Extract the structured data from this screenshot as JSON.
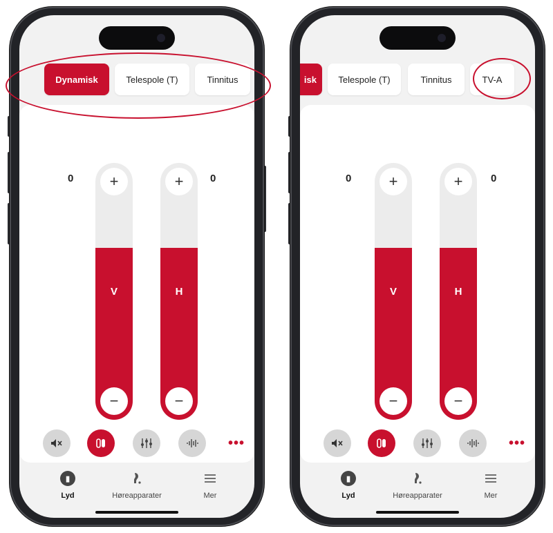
{
  "colors": {
    "accent": "#c8102e",
    "panel": "#ffffff",
    "background": "#f2f2f2"
  },
  "phones": [
    {
      "tabs": [
        {
          "label": "Dynamisk",
          "active": true
        },
        {
          "label": "Telespole (T)",
          "active": false
        },
        {
          "label": "Tinnitus",
          "active": false
        }
      ],
      "left_value": "0",
      "right_value": "0",
      "left_letter": "V",
      "right_letter": "H",
      "left_level": 0.67,
      "right_level": 0.67
    },
    {
      "tabs": [
        {
          "label": "isk",
          "active": true
        },
        {
          "label": "Telespole (T)",
          "active": false
        },
        {
          "label": "Tinnitus",
          "active": false
        },
        {
          "label": "TV-A",
          "active": false
        }
      ],
      "left_value": "0",
      "right_value": "0",
      "left_letter": "V",
      "right_letter": "H",
      "left_level": 0.67,
      "right_level": 0.67
    }
  ],
  "controls": {
    "plus": "+",
    "minus": "−"
  },
  "toolbar": {
    "mute_icon": "speaker-mute-icon",
    "more": "•••"
  },
  "nav": {
    "sound": "Lyd",
    "hearing_aids": "Høreapparater",
    "more": "Mer"
  }
}
